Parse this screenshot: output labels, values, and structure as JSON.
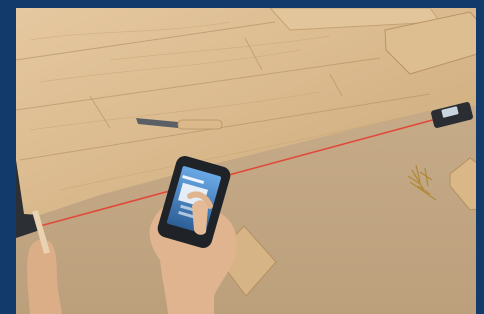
{
  "scene": {
    "colors": {
      "frame": "#123a6b",
      "floorboard": "#d9b98a",
      "underlay": "#c7ab86",
      "laser_line": "#e14a3a",
      "phone": "#1f2328",
      "phone_screen": "#4e8fd0",
      "skin": "#e0b48e",
      "chisel_blade": "#5a5f66",
      "chisel_handle": "#dbb98a"
    },
    "icons": {
      "laser_measure": "laser-measure-device",
      "phone": "smartphone"
    }
  }
}
